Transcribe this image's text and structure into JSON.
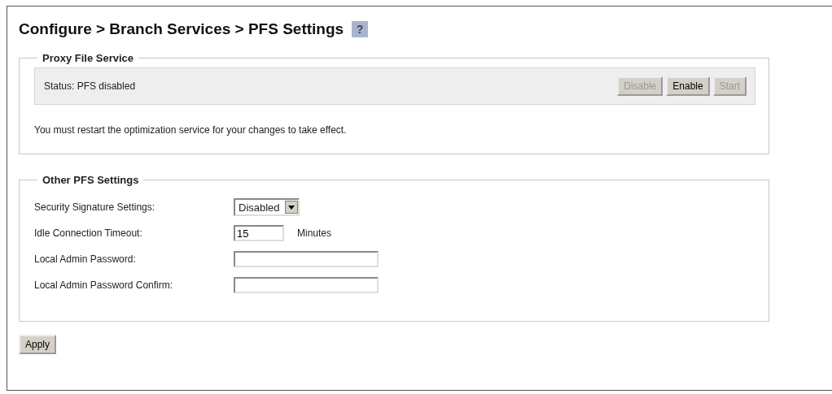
{
  "title": "Configure > Branch Services > PFS Settings",
  "help": "?",
  "proxy_section": {
    "legend": "Proxy File Service",
    "status": "Status: PFS disabled",
    "buttons": [
      {
        "label": "Disable",
        "disabled": true
      },
      {
        "label": "Enable",
        "disabled": false
      },
      {
        "label": "Start",
        "disabled": true
      }
    ],
    "note": "You must restart the optimization service for your changes to take effect."
  },
  "other_section": {
    "legend": "Other PFS Settings",
    "fields": [
      {
        "kind": "select",
        "label": "Security Signature Settings:",
        "value": "Disabled"
      },
      {
        "kind": "short",
        "label": "Idle Connection Timeout:",
        "value": "15",
        "unit": "Minutes"
      },
      {
        "kind": "text",
        "label": "Local Admin Password:"
      },
      {
        "kind": "text",
        "label": "Local Admin Password Confirm:"
      }
    ]
  },
  "apply": "Apply"
}
